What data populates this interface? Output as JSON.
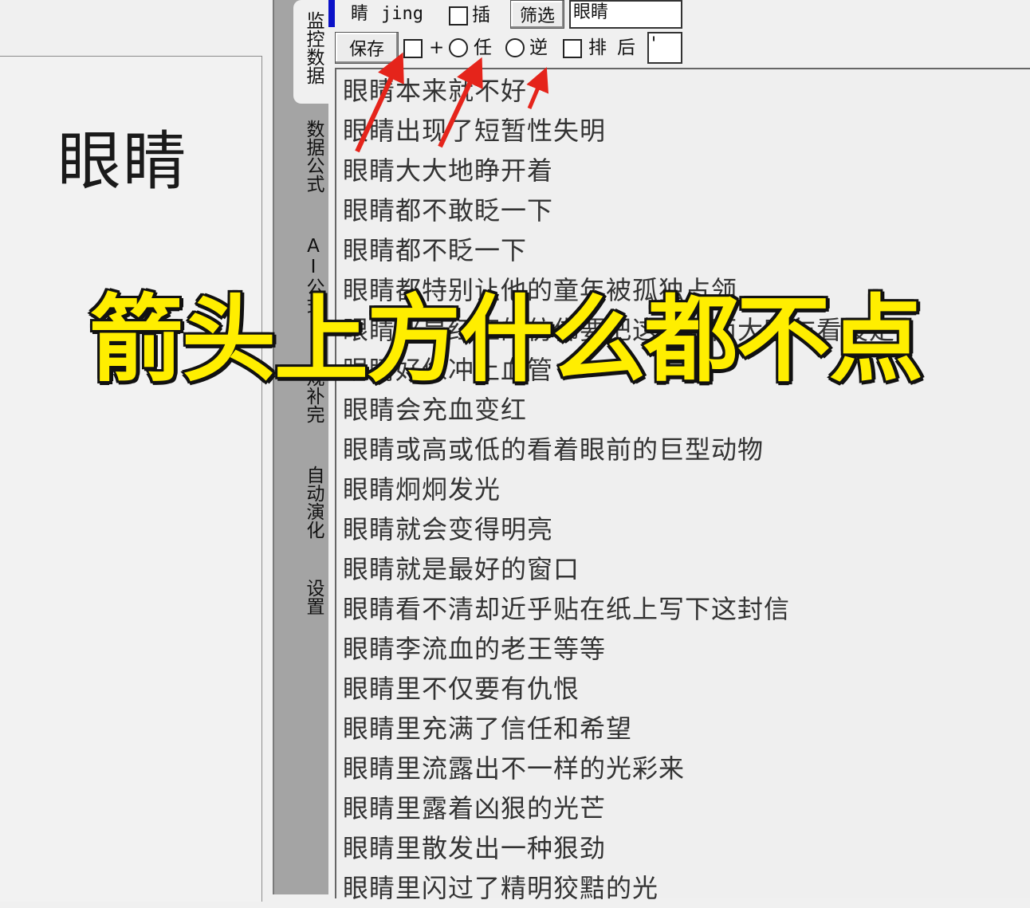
{
  "preview": {
    "word": "眼睛"
  },
  "tabs": [
    {
      "label": "监控数据",
      "active": true
    },
    {
      "label": "数据公式",
      "active": false
    },
    {
      "label": "AI公式",
      "active": false
    },
    {
      "label": "规补完",
      "active": false
    },
    {
      "label": "自动演化",
      "active": false
    },
    {
      "label": "设置",
      "active": false
    }
  ],
  "toolbar": {
    "char": "睛",
    "pinyin": "jing",
    "insert_label": "插",
    "filter_button": "筛选",
    "search_value": "眼睛",
    "save_button": "保存",
    "plus_label": "+",
    "any_label": "任",
    "reverse_label": "逆",
    "sort_label": "排",
    "after_label": "后",
    "after_value": "'"
  },
  "results": [
    "眼睛本来就不好",
    "眼睛出现了短暂性失明",
    "眼睛大大地睁开着",
    "眼睛都不敢眨一下",
    "眼睛都不眨一下",
    "眼睛都特别让他的童年被孤独占领",
    "眼睛都是红红的仿佛要把这个相面大家乍看设定",
    "眼睛好像冲上血管",
    "眼睛会充血变红",
    "眼睛或高或低的看着眼前的巨型动物",
    "眼睛炯炯发光",
    "眼睛就会变得明亮",
    "眼睛就是最好的窗口",
    "眼睛看不清却近乎贴在纸上写下这封信",
    "眼睛李流血的老王等等",
    "眼睛里不仅要有仇恨",
    "眼睛里充满了信任和希望",
    "眼睛里流露出不一样的光彩来",
    "眼睛里露着凶狠的光芒",
    "眼睛里散发出一种狠劲",
    "眼睛里闪过了精明狡黠的光"
  ],
  "overlay": {
    "caption": "箭头上方什么都不点"
  },
  "colors": {
    "arrow": "#e5241b",
    "banner_fill": "#ffee00",
    "banner_stroke": "#111111",
    "marker": "#0b12c8"
  }
}
